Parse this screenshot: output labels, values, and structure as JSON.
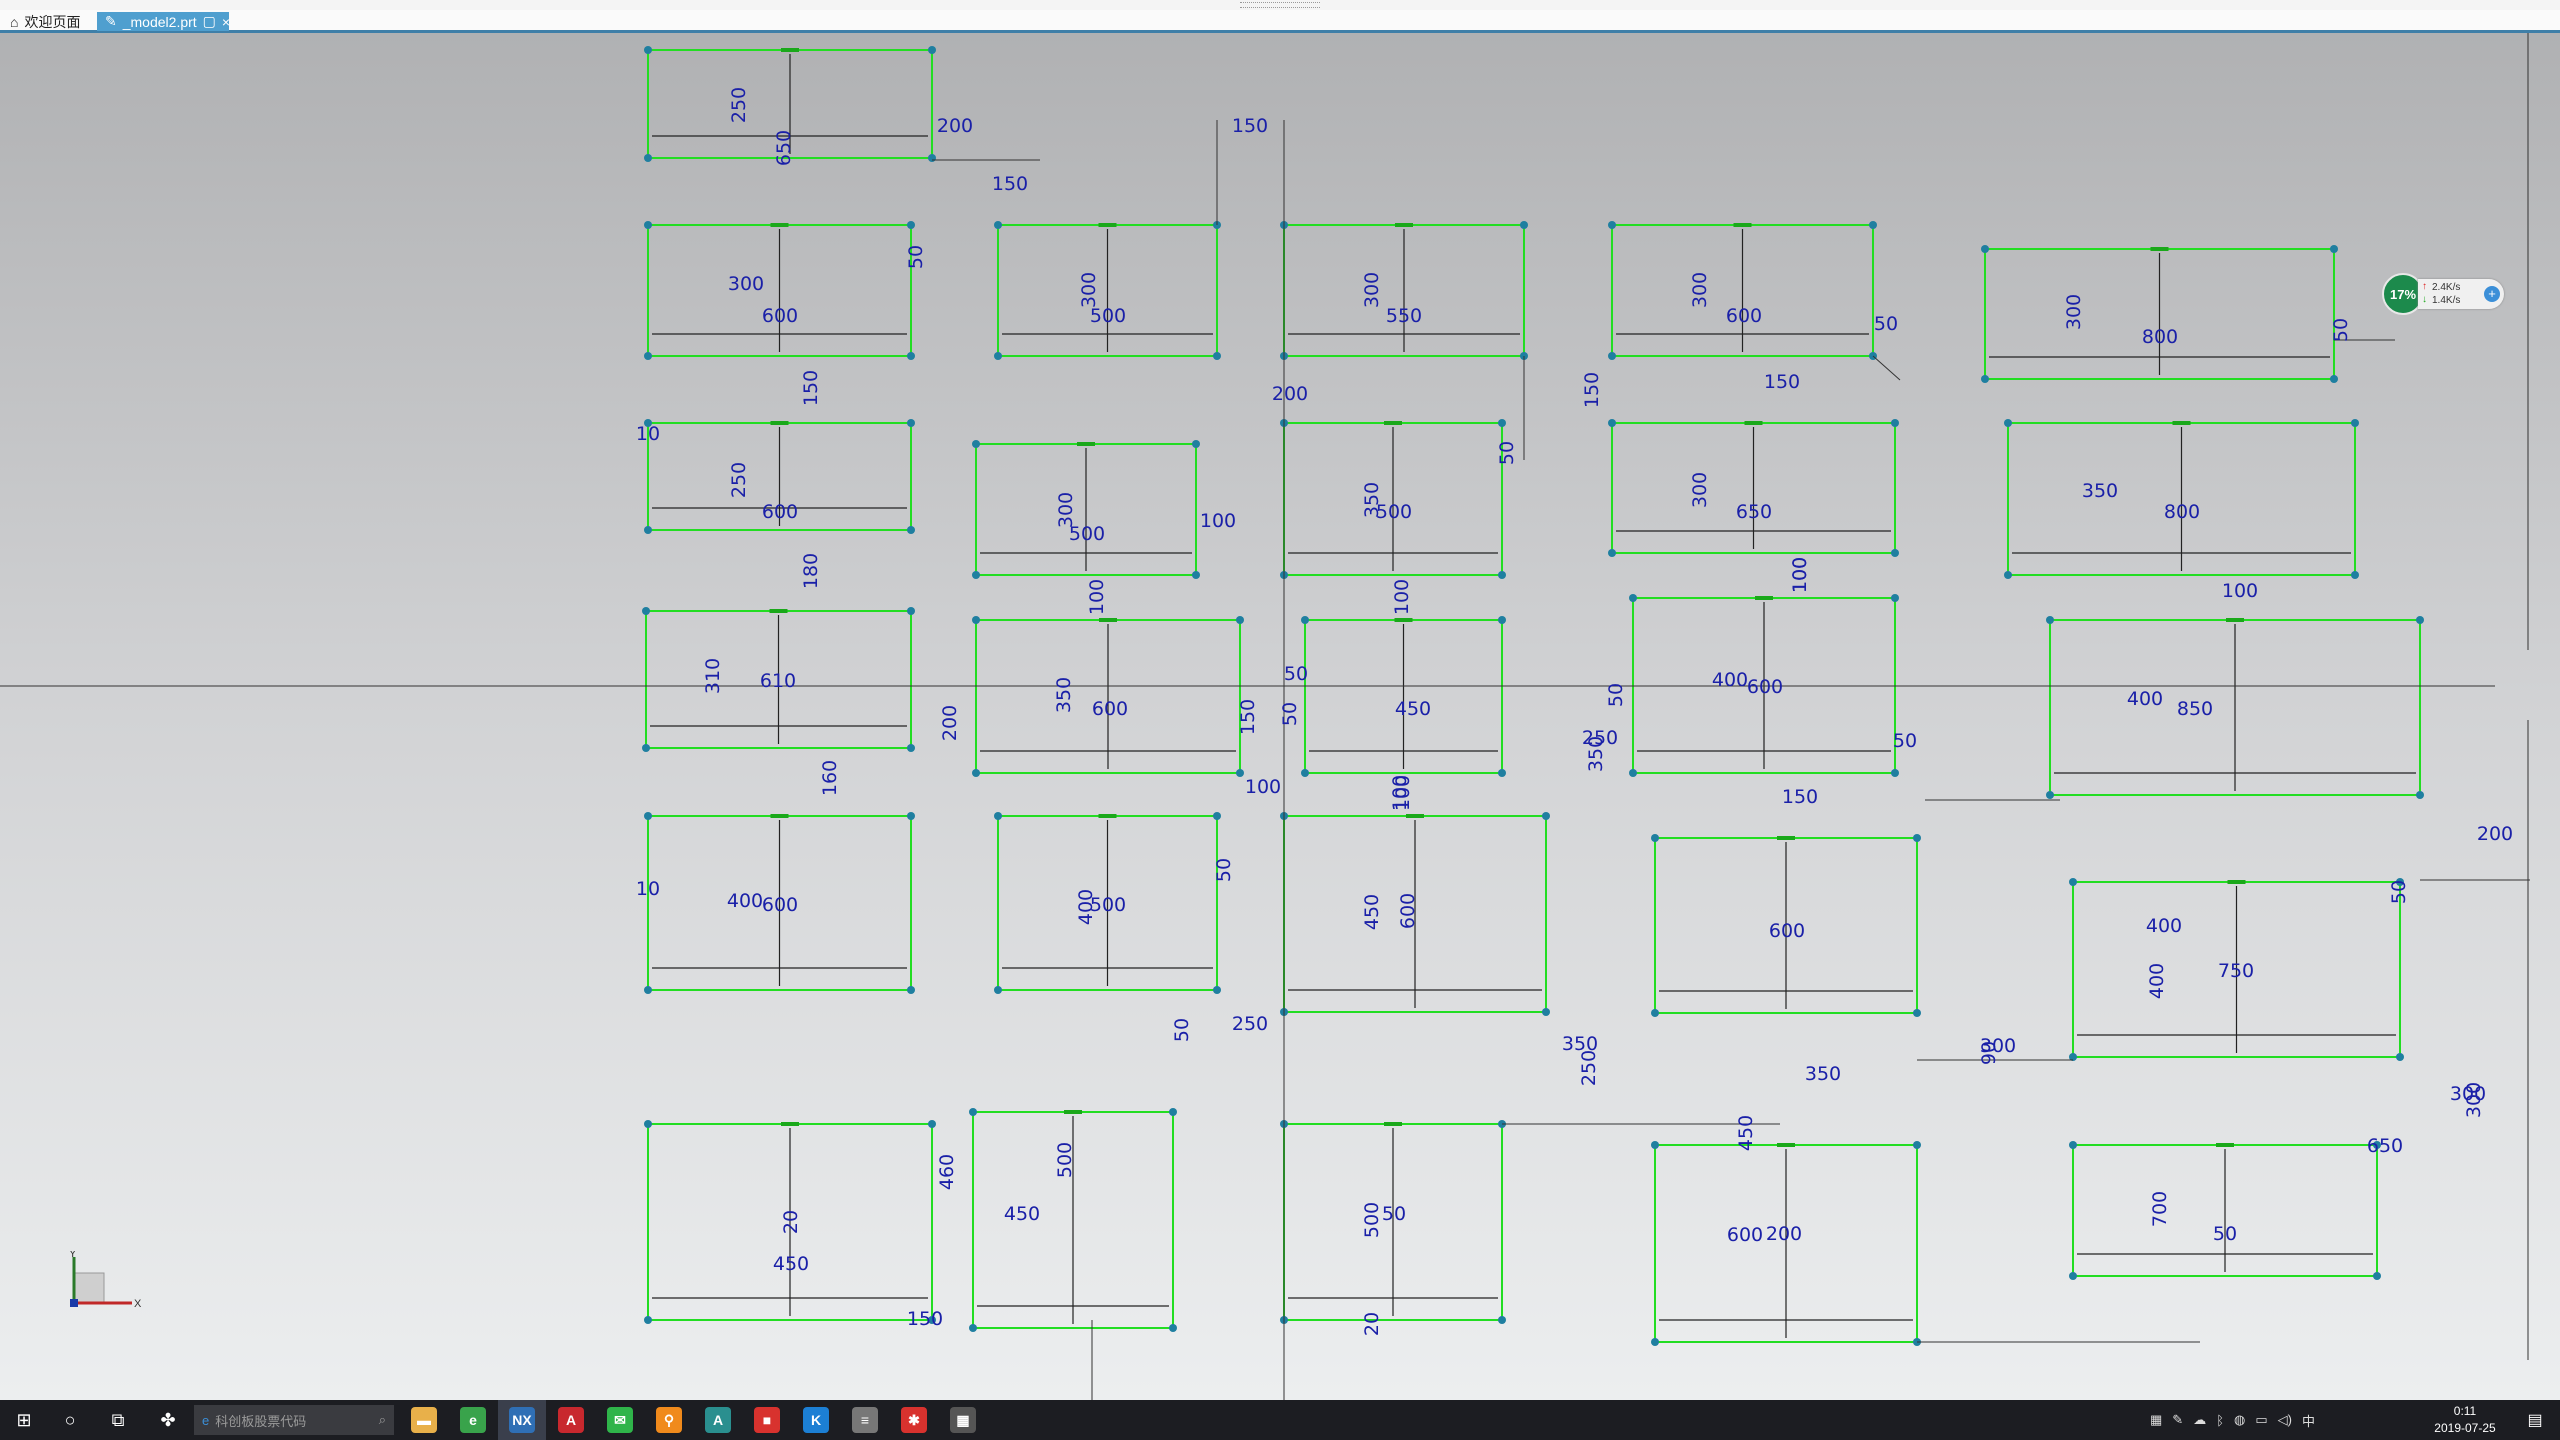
{
  "tabs": [
    {
      "label": "欢迎页面",
      "icon": "home-icon",
      "active": false
    },
    {
      "label": "_model2.prt",
      "icon": "part-icon",
      "active": true,
      "close_label": "×"
    }
  ],
  "network_widget": {
    "percent": "17%",
    "upload": "2.4K/s",
    "download": "1.4K/s",
    "add_label": "+"
  },
  "axes": {
    "x_label": "X",
    "y_label": "Y"
  },
  "dimensions": [
    "250",
    "650",
    "200",
    "150",
    "150",
    "50",
    "300",
    "600",
    "300",
    "500",
    "300",
    "550",
    "300",
    "600",
    "50",
    "300",
    "800",
    "50",
    "150",
    "10",
    "250",
    "600",
    "300",
    "500",
    "100",
    "200",
    "350",
    "500",
    "150",
    "50",
    "150",
    "300",
    "650",
    "100",
    "350",
    "800",
    "180",
    "100",
    "100",
    "100",
    "100",
    "310",
    "610",
    "350",
    "600",
    "50",
    "50",
    "450",
    "400",
    "600",
    "50",
    "400",
    "850",
    "200",
    "150",
    "250",
    "50",
    "100",
    "160",
    "100",
    "100",
    "350",
    "10",
    "400",
    "600",
    "400",
    "500",
    "450",
    "600",
    "50",
    "150",
    "400",
    "600",
    "400",
    "750",
    "50",
    "200",
    "50",
    "250",
    "350",
    "250",
    "300",
    "350",
    "300",
    "90",
    "460",
    "500",
    "450",
    "500",
    "50",
    "450",
    "600",
    "200",
    "300",
    "700",
    "50",
    "650",
    "450",
    "20",
    "20",
    "150"
  ],
  "taskbar": {
    "search_placeholder": "科创板股票代码",
    "apps": [
      {
        "name": "file-explorer",
        "icon": "folder-icon",
        "color": "#e8b04a"
      },
      {
        "name": "360-browser",
        "icon": "green-circle-icon",
        "color": "#39a34b"
      },
      {
        "name": "nx",
        "icon": "nx-icon",
        "color": "#2f6fb5"
      },
      {
        "name": "altium",
        "icon": "red-app-icon",
        "color": "#c8282e"
      },
      {
        "name": "wechat",
        "icon": "wechat-icon",
        "color": "#2fb44a"
      },
      {
        "name": "search-tool",
        "icon": "magnifier-icon",
        "color": "#f08a1c"
      },
      {
        "name": "text-app",
        "icon": "a-letter-icon",
        "color": "#2a8f8f"
      },
      {
        "name": "red-app",
        "icon": "red-square-icon",
        "color": "#d8322e"
      },
      {
        "name": "k-app",
        "icon": "k-icon",
        "color": "#1c7fd4"
      },
      {
        "name": "doc-app",
        "icon": "doc-icon",
        "color": "#777777"
      },
      {
        "name": "star-app",
        "icon": "star-icon",
        "color": "#d8322e"
      },
      {
        "name": "calculator",
        "icon": "calculator-icon",
        "color": "#555555"
      }
    ],
    "clock_time": "0:11",
    "clock_date": "2019-07-25"
  },
  "colors": {
    "geometry": "#22dd22",
    "dimension": "#1a20a8",
    "accent_tab": "#4f9fcf"
  }
}
